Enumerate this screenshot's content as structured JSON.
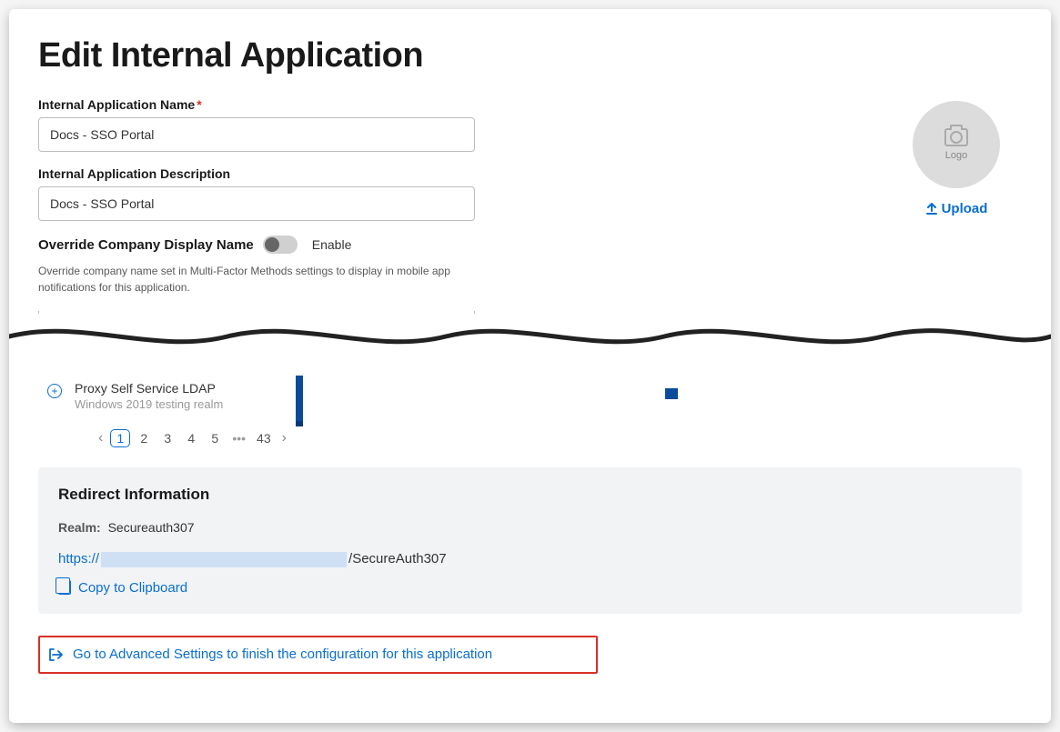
{
  "header": {
    "title": "Edit Internal Application"
  },
  "form": {
    "name_label": "Internal Application Name",
    "name_value": "Docs - SSO Portal",
    "description_label": "Internal Application Description",
    "description_value": "Docs - SSO Portal",
    "override_label": "Override Company Display Name",
    "enable_text": "Enable",
    "help_text": "Override company name set in Multi-Factor Methods settings to display in mobile app notifications for this application."
  },
  "logo": {
    "placeholder_text": "Logo",
    "upload_label": "Upload"
  },
  "list": {
    "item_title": "Proxy Self Service LDAP",
    "item_subtitle": "Windows 2019 testing realm"
  },
  "pagination": {
    "p1": "1",
    "p2": "2",
    "p3": "3",
    "p4": "4",
    "p5": "5",
    "last": "43"
  },
  "redirect": {
    "title": "Redirect Information",
    "realm_label": "Realm:",
    "realm_value": "Secureauth307",
    "url_scheme": "https://",
    "url_path": "/SecureAuth307",
    "copy_label": "Copy to Clipboard"
  },
  "advanced_link": {
    "text": "Go to Advanced Settings to finish the configuration for this application"
  }
}
